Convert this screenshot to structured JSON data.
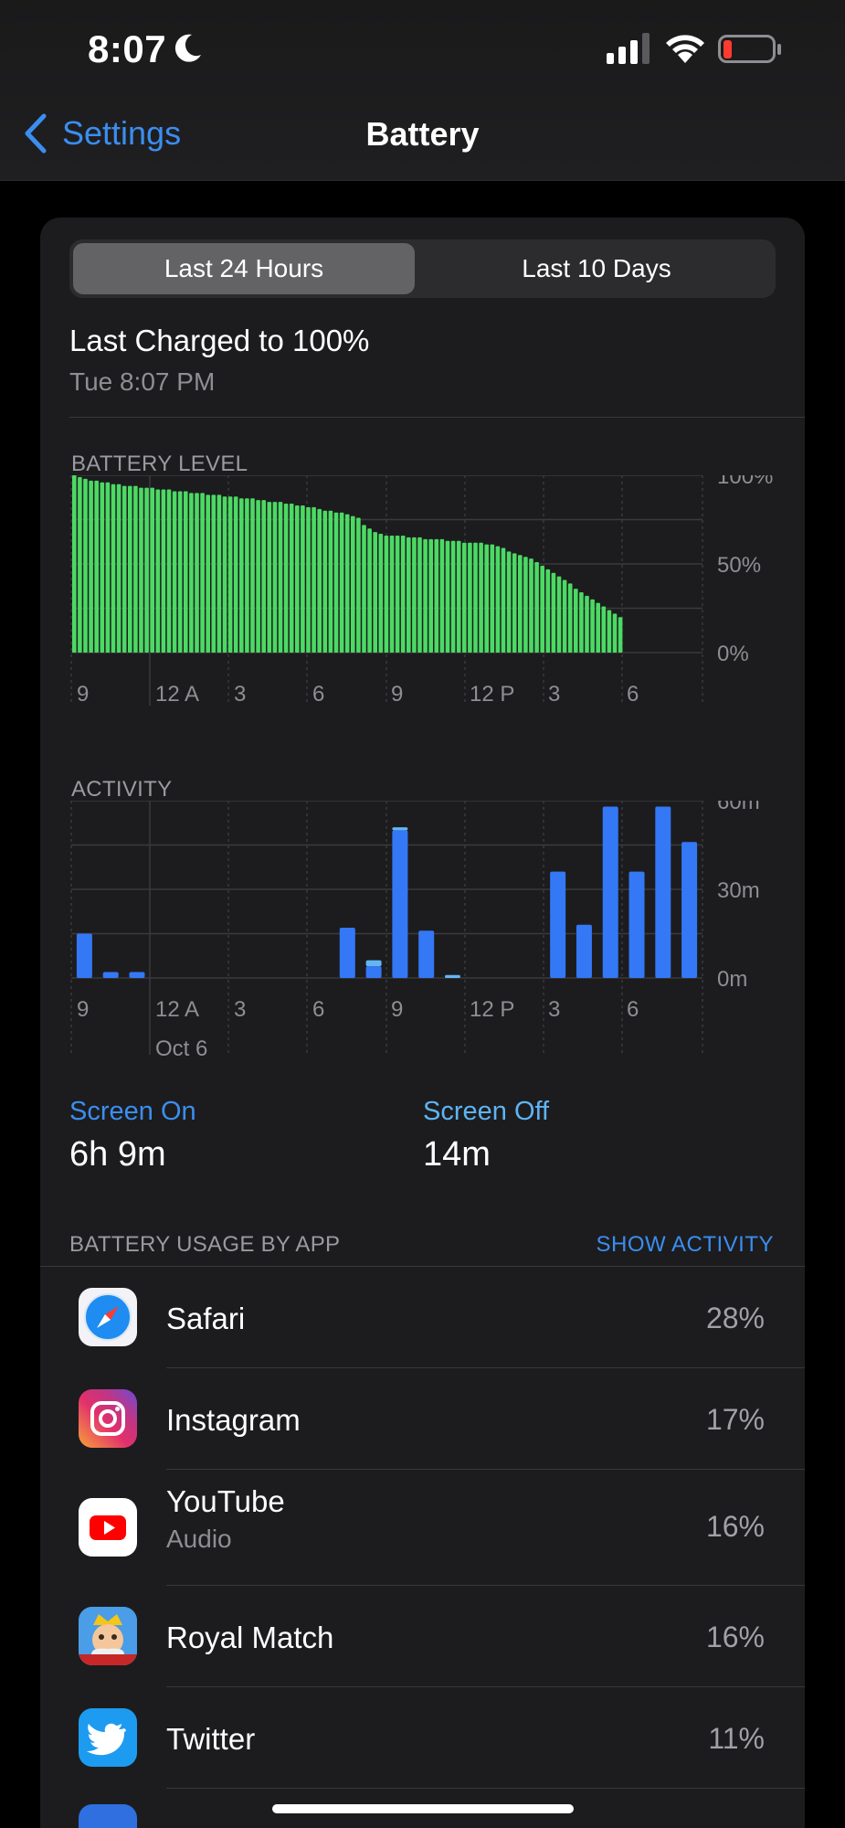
{
  "status_bar": {
    "time": "8:07"
  },
  "nav": {
    "back_label": "Settings",
    "title": "Battery"
  },
  "segments": {
    "active": "Last 24 Hours",
    "inactive": "Last 10 Days"
  },
  "last_charged": {
    "title": "Last Charged to 100%",
    "time": "Tue 8:07 PM"
  },
  "chart_data": [
    {
      "type": "bar",
      "title": "BATTERY LEVEL",
      "x_tick_labels": [
        "9",
        "12 A",
        "3",
        "6",
        "9",
        "12 P",
        "3",
        "6"
      ],
      "y_tick_labels": [
        "100%",
        "50%",
        "0%"
      ],
      "ylim": [
        0,
        100
      ],
      "color": "#4cd964",
      "values": [
        100,
        99,
        98,
        97,
        97,
        96,
        96,
        95,
        95,
        94,
        94,
        94,
        93,
        93,
        93,
        92,
        92,
        92,
        91,
        91,
        91,
        90,
        90,
        90,
        89,
        89,
        89,
        88,
        88,
        88,
        87,
        87,
        87,
        86,
        86,
        85,
        85,
        85,
        84,
        84,
        83,
        83,
        82,
        82,
        81,
        80,
        80,
        79,
        79,
        78,
        77,
        76,
        72,
        70,
        68,
        67,
        66,
        66,
        66,
        66,
        65,
        65,
        65,
        64,
        64,
        64,
        64,
        63,
        63,
        63,
        62,
        62,
        62,
        62,
        61,
        61,
        60,
        59,
        57,
        56,
        55,
        54,
        53,
        51,
        49,
        47,
        45,
        43,
        41,
        39,
        36,
        34,
        32,
        30,
        28,
        26,
        24,
        22,
        20
      ]
    },
    {
      "type": "bar",
      "title": "ACTIVITY",
      "x_tick_labels": [
        "9",
        "12 A",
        "3",
        "6",
        "9",
        "12 P",
        "3",
        "6"
      ],
      "date_label": "Oct 6",
      "y_tick_labels": [
        "60m",
        "30m",
        "0m"
      ],
      "ylim": [
        0,
        60
      ],
      "series": [
        {
          "name": "Screen On",
          "color": "#3478f6",
          "values": [
            15,
            2,
            2,
            0,
            0,
            0,
            0,
            0,
            0,
            0,
            17,
            4,
            50,
            16,
            0,
            0,
            0,
            0,
            36,
            18,
            58,
            36,
            58,
            46
          ]
        },
        {
          "name": "Screen Off",
          "color": "#64b5f6",
          "values": [
            0,
            0,
            0,
            0,
            0,
            0,
            0,
            0,
            0,
            0,
            0,
            2,
            1,
            0,
            1,
            0,
            0,
            0,
            0,
            0,
            0,
            0,
            0,
            0
          ]
        }
      ]
    }
  ],
  "screen_time": {
    "on_label": "Screen On",
    "on_value": "6h 9m",
    "off_label": "Screen Off",
    "off_value": "14m"
  },
  "usage": {
    "label": "BATTERY USAGE BY APP",
    "action": "SHOW ACTIVITY",
    "apps": [
      {
        "name": "Safari",
        "sub": "",
        "pct": "28%",
        "icon": "safari-icon"
      },
      {
        "name": "Instagram",
        "sub": "",
        "pct": "17%",
        "icon": "instagram-icon"
      },
      {
        "name": "YouTube",
        "sub": "Audio",
        "pct": "16%",
        "icon": "youtube-icon"
      },
      {
        "name": "Royal Match",
        "sub": "",
        "pct": "16%",
        "icon": "royal-match-icon"
      },
      {
        "name": "Twitter",
        "sub": "",
        "pct": "11%",
        "icon": "twitter-icon"
      }
    ]
  }
}
